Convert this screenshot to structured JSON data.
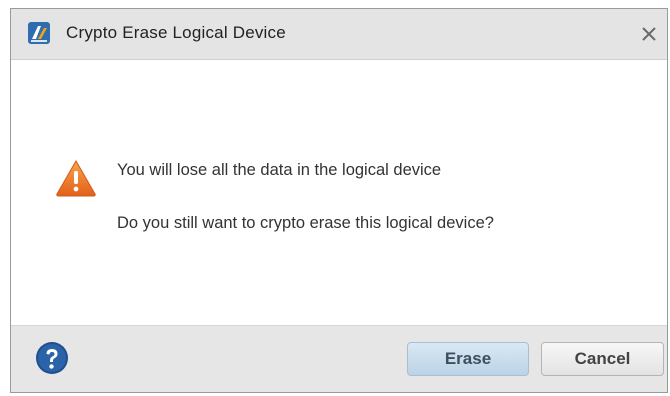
{
  "dialog": {
    "title": "Crypto Erase Logical Device",
    "close_glyph": "✕",
    "icons": {
      "app": "app-logo-icon",
      "close": "close-icon",
      "warning": "warning-icon",
      "help": "help-icon"
    },
    "message_line1": "You will lose all the data in the logical device",
    "message_line2": "Do you still want to crypto erase this logical device?",
    "buttons": {
      "erase_label": "Erase",
      "cancel_label": "Cancel"
    },
    "colors": {
      "warning": "#f07c1e",
      "help": "#1f4f8f",
      "primary_button": "#c7dced"
    }
  }
}
